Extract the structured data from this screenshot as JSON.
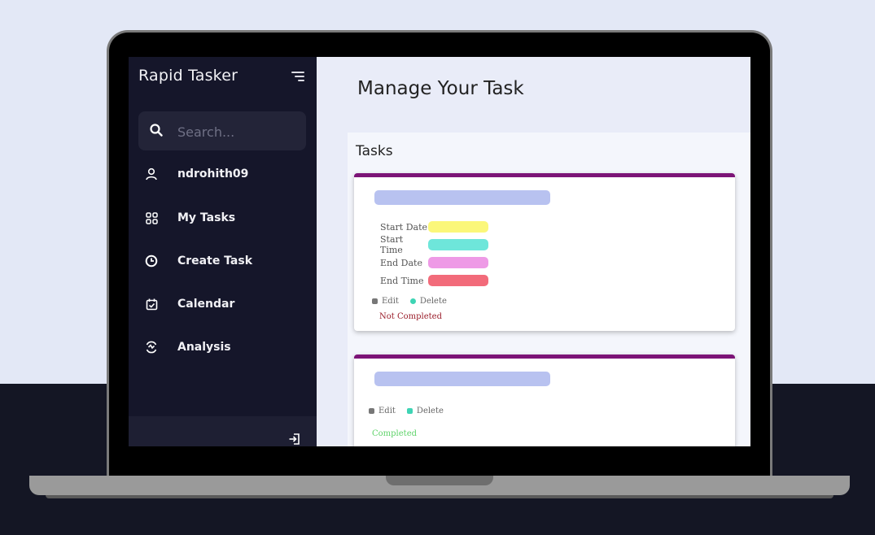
{
  "app": {
    "name": "Rapid Tasker"
  },
  "search": {
    "placeholder": "Search..."
  },
  "sidebar": {
    "items": [
      {
        "label": "ndrohith09",
        "icon": "user-icon"
      },
      {
        "label": "My Tasks",
        "icon": "grid-icon"
      },
      {
        "label": "Create Task",
        "icon": "clock-icon"
      },
      {
        "label": "Calendar",
        "icon": "calendar-check-icon"
      },
      {
        "label": "Analysis",
        "icon": "analytics-icon"
      }
    ],
    "logout_icon": "logout-icon"
  },
  "main": {
    "title": "Manage Your Task",
    "section_title": "Tasks",
    "cards": [
      {
        "fields": [
          {
            "label": "Start Date",
            "color": "#fbf77a"
          },
          {
            "label": "Start Time",
            "color": "#6ee6da"
          },
          {
            "label": "End Date",
            "color": "#ee9ae6"
          },
          {
            "label": "End Time",
            "color": "#f26b7a"
          }
        ],
        "edit_label": "Edit",
        "delete_label": "Delete",
        "status": "Not Completed",
        "status_color": "#9b1f2c"
      },
      {
        "edit_label": "Edit",
        "delete_label": "Delete",
        "status": "Completed",
        "status_color": "#5fd36a"
      }
    ]
  },
  "colors": {
    "sidebar_bg": "#15162a",
    "card_accent": "#7c1477",
    "title_bar": "#b8c2f0",
    "edit_dot": "#777777",
    "delete_dot": "#3ed4b4"
  }
}
